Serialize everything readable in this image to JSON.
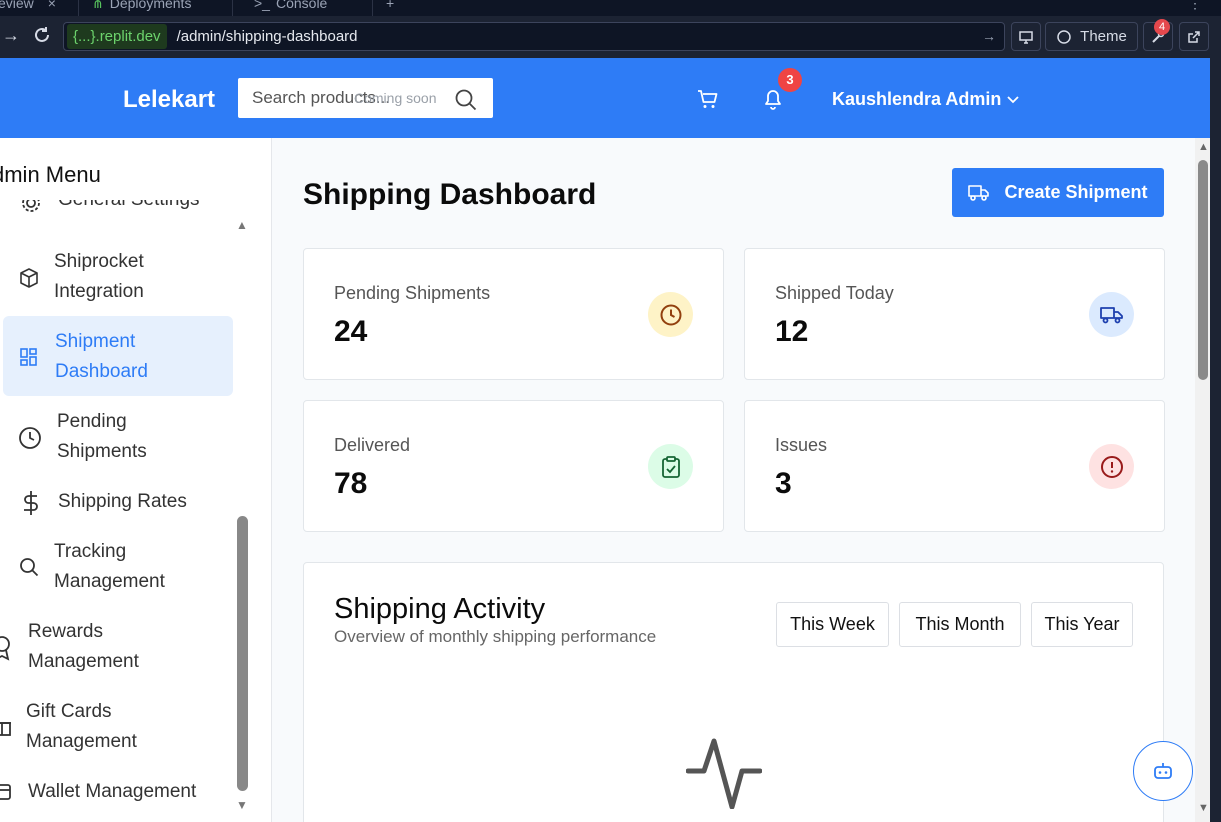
{
  "browser": {
    "tabs": [
      "eview",
      "Deployments",
      "Console"
    ],
    "url_host": "{...}.replit.dev",
    "url_path": "/admin/shipping-dashboard",
    "theme_label": "Theme",
    "tools_badge": "4"
  },
  "header": {
    "brand": "Lelekart",
    "search_placeholder": "Search products...",
    "search_note": "Coming soon",
    "notification_count": "3",
    "user_name": "Kaushlendra Admin"
  },
  "sidebar": {
    "title": "dmin Menu",
    "items": [
      {
        "label": "General Settings",
        "icon": "gear-icon"
      },
      {
        "label": "Shiprocket Integration",
        "icon": "package-icon"
      },
      {
        "label": "Shipment Dashboard",
        "icon": "dashboard-icon",
        "active": true
      },
      {
        "label": "Pending Shipments",
        "icon": "clock-icon"
      },
      {
        "label": "Shipping Rates",
        "icon": "dollar-icon"
      },
      {
        "label": "Tracking Management",
        "icon": "search-icon"
      },
      {
        "label": "Rewards Management",
        "icon": "award-icon"
      },
      {
        "label": "Gift Cards Management",
        "icon": "gift-icon"
      },
      {
        "label": "Wallet Management",
        "icon": "wallet-icon"
      }
    ]
  },
  "main": {
    "title": "Shipping Dashboard",
    "create_button": "Create Shipment",
    "cards": [
      {
        "label": "Pending Shipments",
        "value": "24",
        "icon": "clock-icon",
        "color": "#fef3c7",
        "icon_color": "#92400e"
      },
      {
        "label": "Shipped Today",
        "value": "12",
        "icon": "truck-icon",
        "color": "#dbeafe",
        "icon_color": "#1e40af"
      },
      {
        "label": "Delivered",
        "value": "78",
        "icon": "clipboard-check-icon",
        "color": "#dcfce7",
        "icon_color": "#166534"
      },
      {
        "label": "Issues",
        "value": "3",
        "icon": "alert-circle-icon",
        "color": "#fee2e2",
        "icon_color": "#991b1b"
      }
    ],
    "activity": {
      "title": "Shipping Activity",
      "subtitle": "Overview of monthly shipping performance",
      "ranges": [
        "This Week",
        "This Month",
        "This Year"
      ]
    }
  },
  "colors": {
    "primary": "#2e7cf6",
    "active_bg": "#e6f0fd",
    "badge": "#ef4444"
  }
}
